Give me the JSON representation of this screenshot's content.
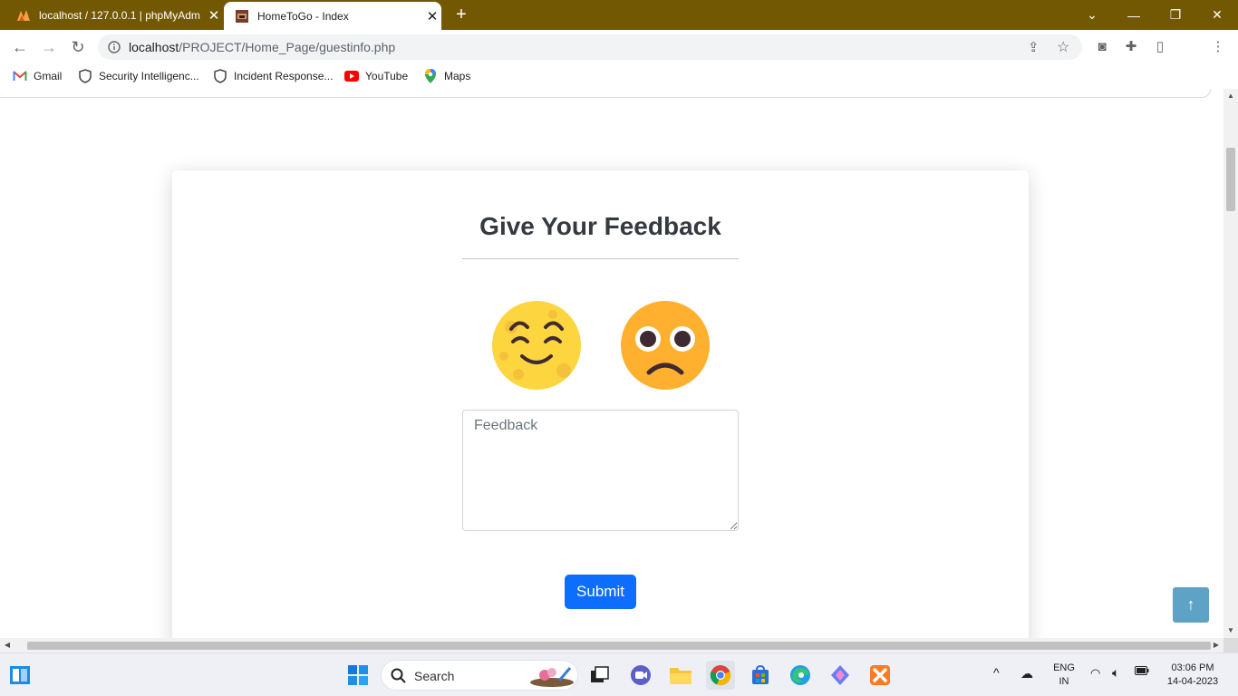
{
  "browser": {
    "tabs": [
      {
        "title": "localhost / 127.0.0.1 | phpMyAdm",
        "active": false
      },
      {
        "title": "HomeToGo - Index",
        "active": true
      }
    ],
    "url_host": "localhost",
    "url_path": "/PROJECT/Home_Page/guestinfo.php",
    "bookmarks": [
      "Gmail",
      "Security Intelligenc...",
      "Incident Response...",
      "YouTube",
      "Maps"
    ]
  },
  "page": {
    "title": "Give Your Feedback",
    "feedback_placeholder": "Feedback",
    "submit_label": "Submit",
    "emojis": [
      "relieved-face",
      "frowning-face"
    ],
    "colors": {
      "accent": "#0d6efd",
      "titlebar": "#735804",
      "scroll_top": "#5ea2c6"
    }
  },
  "taskbar": {
    "search_label": "Search",
    "language": "ENG",
    "region": "IN",
    "time": "03:06 PM",
    "date": "14-04-2023"
  }
}
